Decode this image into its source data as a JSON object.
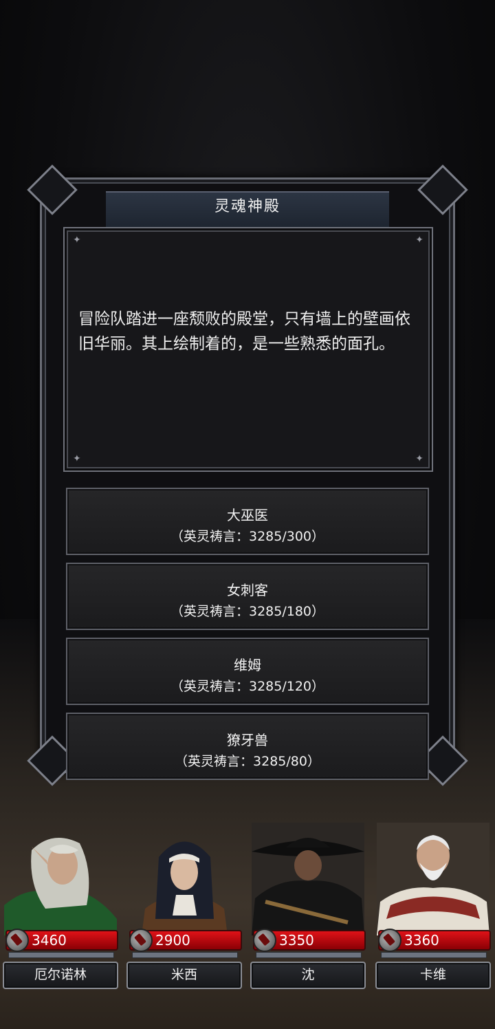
{
  "event": {
    "title": "灵魂神殿",
    "story": "冒险队踏进一座颓败的殿堂，只有墙上的壁画依旧华丽。其上绘制着的，是一些熟悉的面孔。"
  },
  "options": [
    {
      "name": "大巫医",
      "cost": "（英灵祷言：3285/300）"
    },
    {
      "name": "女刺客",
      "cost": "（英灵祷言：3285/180）"
    },
    {
      "name": "维姆",
      "cost": "（英灵祷言：3285/120）"
    },
    {
      "name": "獠牙兽",
      "cost": "（英灵祷言：3285/80）"
    }
  ],
  "party": [
    {
      "name": "厄尔诺林",
      "hp": "3460"
    },
    {
      "name": "米西",
      "hp": "2900"
    },
    {
      "name": "沈",
      "hp": "3350"
    },
    {
      "name": "卡维",
      "hp": "3360"
    }
  ],
  "colors": {
    "hp_fill": "#d10f16",
    "frame": "#6a6d76",
    "title_band": "#253040"
  }
}
